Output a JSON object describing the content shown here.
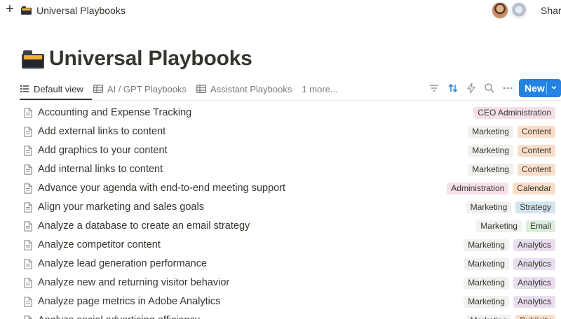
{
  "topbar": {
    "breadcrumb": "Universal Playbooks",
    "share_label": "Share"
  },
  "page": {
    "title": "Universal Playbooks"
  },
  "views": [
    {
      "label": "Default view",
      "icon": "list-icon",
      "active": true
    },
    {
      "label": "AI / GPT Playbooks",
      "icon": "table-icon",
      "active": false
    },
    {
      "label": "Assistant Playbooks",
      "icon": "table-icon",
      "active": false
    },
    {
      "label": "1 more...",
      "icon": "",
      "active": false
    }
  ],
  "toolbar": {
    "new_label": "New",
    "accent": "#2383e2"
  },
  "tag_colors": {
    "CEO Administration": "#f5e0e9",
    "Marketing": "#f1f1ef",
    "Content": "#fadec9",
    "Administration": "#f5e0e9",
    "Calendar": "#fadec9",
    "Strategy": "#d3e5ef",
    "Email": "#dbeddb",
    "Analytics": "#e8deee",
    "Publicity": "#fadec9"
  },
  "rows": [
    {
      "name": "Accounting and Expense Tracking",
      "tags": [
        "CEO Administration"
      ]
    },
    {
      "name": "Add external links to content",
      "tags": [
        "Marketing",
        "Content"
      ]
    },
    {
      "name": "Add graphics to your content",
      "tags": [
        "Marketing",
        "Content"
      ]
    },
    {
      "name": "Add internal links to content",
      "tags": [
        "Marketing",
        "Content"
      ]
    },
    {
      "name": "Advance your agenda with end-to-end meeting support",
      "tags": [
        "Administration",
        "Calendar"
      ]
    },
    {
      "name": "Align your marketing and sales goals",
      "tags": [
        "Marketing",
        "Strategy"
      ]
    },
    {
      "name": "Analyze a database to create an email strategy",
      "tags": [
        "Marketing",
        "Email"
      ]
    },
    {
      "name": "Analyze competitor content",
      "tags": [
        "Marketing",
        "Analytics"
      ]
    },
    {
      "name": "Analyze lead generation performance",
      "tags": [
        "Marketing",
        "Analytics"
      ]
    },
    {
      "name": "Analyze new and returning visitor behavior",
      "tags": [
        "Marketing",
        "Analytics"
      ]
    },
    {
      "name": "Analyze page metrics in Adobe Analytics",
      "tags": [
        "Marketing",
        "Analytics"
      ]
    },
    {
      "name": "Analyze social advertising efficiency",
      "tags": [
        "Marketing",
        "Publicity"
      ]
    }
  ]
}
